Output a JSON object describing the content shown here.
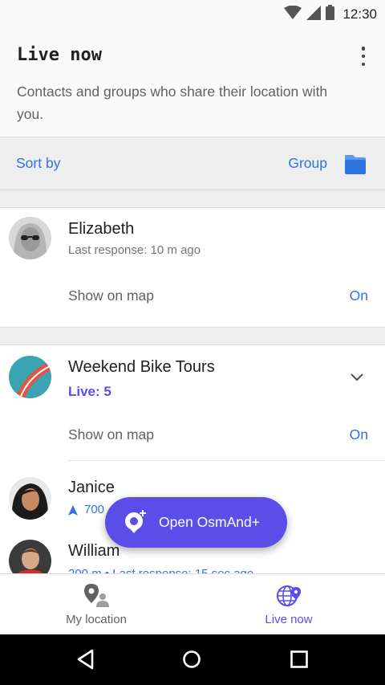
{
  "status_bar": {
    "time": "12:30"
  },
  "header": {
    "title": "Live now",
    "description": "Contacts and groups who share their location with you."
  },
  "sort_bar": {
    "sort_label": "Sort by",
    "group_label": "Group"
  },
  "contacts": [
    {
      "name": "Elizabeth",
      "last_response": "Last response: 10 m ago",
      "show_on_map_label": "Show on map",
      "show_on_map_value": "On"
    }
  ],
  "group": {
    "name": "Weekend Bike Tours",
    "live_count": "Live: 5",
    "show_on_map_label": "Show on map",
    "show_on_map_value": "On",
    "members": [
      {
        "name": "Janice",
        "distance": "700"
      },
      {
        "name": "William",
        "status": "200 m • Last response: 15 sec ago"
      }
    ]
  },
  "fab": {
    "label": "Open OsmAnd+"
  },
  "bottom_nav": {
    "my_location_label": "My location",
    "live_now_label": "Live now"
  },
  "colors": {
    "accent_blue": "#2f73e0",
    "fab_purple": "#5b4ee8",
    "band_gray": "#eeeeee"
  }
}
